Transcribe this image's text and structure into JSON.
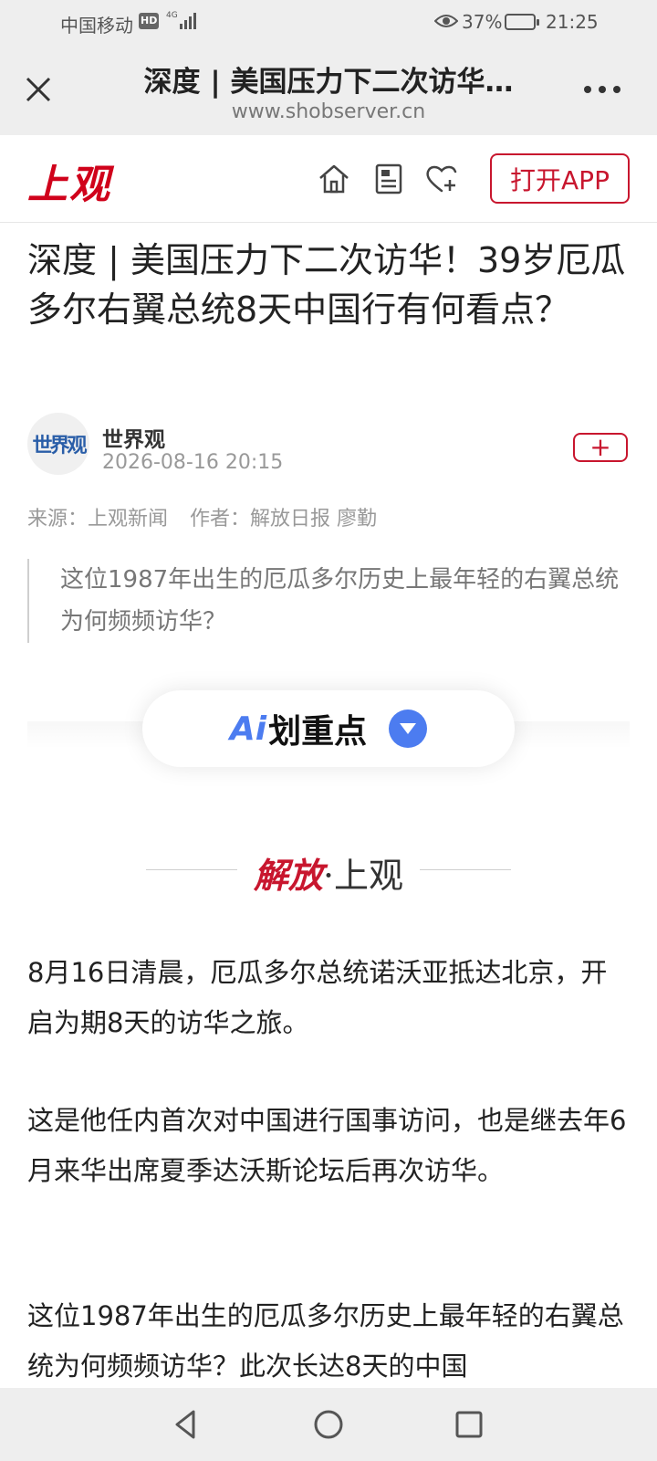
{
  "status_bar": {
    "carrier": "中国移动",
    "hd_badge": "HD",
    "network": "4G",
    "battery": "37%",
    "time": "21:25"
  },
  "browser": {
    "title": "深度 | 美国压力下二次访华…",
    "domain": "www.shobserver.cn"
  },
  "site": {
    "logo": "上观",
    "open_app": "打开APP"
  },
  "article": {
    "title": "深度 | 美国压力下二次访华！39岁厄瓜多尔右翼总统8天中国行有何看点？",
    "author": {
      "avatar_text": "世界观",
      "name": "世界观",
      "time": "2026-08-16 20:15",
      "follow": "+"
    },
    "source": "来源：上观新闻",
    "byline": "作者：解放日报 廖勤",
    "summary": "这位1987年出生的厄瓜多尔历史上最年轻的右翼总统为何频频访华？",
    "ai": {
      "mark": "Ai",
      "label": "划重点"
    },
    "brand": {
      "red": "解放",
      "sep": "·",
      "black": "上观"
    },
    "paragraphs": [
      "8月16日清晨，厄瓜多尔总统诺沃亚抵达北京，开启为期8天的访华之旅。",
      "这是他任内首次对中国进行国事访问，也是继去年6月来华出席夏季达沃斯论坛后再次访华。",
      "这位1987年出生的厄瓜多尔历史上最年轻的右翼总统为何频频访华？此次长达8天的中国"
    ]
  },
  "colors": {
    "accent_red": "#c8162e",
    "ai_blue": "#4c7cf0",
    "bar_gray": "#eeeeee"
  },
  "icons": [
    "close-icon",
    "more-icon",
    "home-icon",
    "news-icon",
    "heart-add-icon",
    "back-icon",
    "home-circle-icon",
    "recents-icon",
    "eye-icon",
    "signal-icon",
    "battery-icon"
  ]
}
